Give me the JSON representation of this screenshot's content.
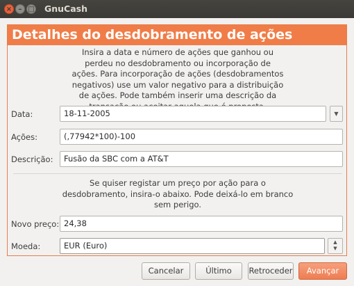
{
  "window": {
    "title": "GnuCash",
    "close_glyph": "×",
    "min_glyph": "–",
    "max_glyph": "□"
  },
  "page": {
    "title": "Detalhes do desdobramento de ações",
    "intro_lines": [
      "Insira a data e número de ações que ganhou ou",
      "perdeu no desdobramento ou incorporação de",
      "ações. Para incorporação de ações (desdobramentos",
      "negativos) use um valor negativo para a distribuição",
      "de ações. Pode também inserir uma descrição da",
      "transação ou aceitar aquela que é proposta."
    ],
    "price_intro_lines": [
      "Se quiser registar um preço por ação para o",
      "desdobramento, insira-o abaixo. Pode deixá-lo em branco",
      "sem perigo."
    ]
  },
  "form": {
    "date": {
      "label": "Data:",
      "value": "18-11-2005",
      "button_glyph": "▼"
    },
    "shares": {
      "label": "Ações:",
      "value": "(,77942*100)-100"
    },
    "description": {
      "label": "Descrição:",
      "value": "Fusão da SBC com a AT&T"
    },
    "new_price": {
      "label": "Novo preço:",
      "value": "24,38"
    },
    "currency": {
      "label": "Moeda:",
      "value": "EUR (Euro)",
      "up_glyph": "▲",
      "down_glyph": "▼"
    }
  },
  "buttons": {
    "cancel": "Cancelar",
    "last": "Último",
    "back": "Retroceder",
    "forward": "Avançar"
  },
  "colors": {
    "accent": "#f07d48",
    "titlebar": "#3c3b37",
    "close": "#e9623a"
  },
  "icons": {
    "date_dropdown": "chevron-down-icon",
    "currency_spinner": "spin-arrows-icon"
  }
}
